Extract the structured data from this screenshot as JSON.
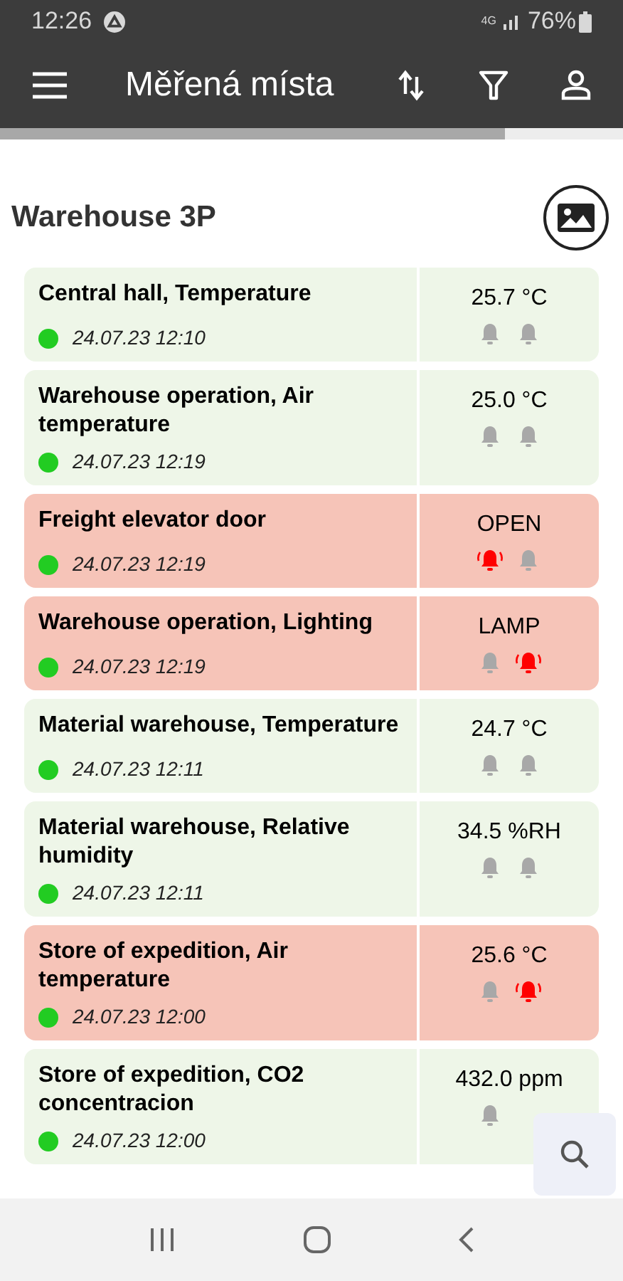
{
  "status_bar": {
    "time": "12:26",
    "network": "4G",
    "battery": "76%"
  },
  "app_bar": {
    "title": "Měřená místa"
  },
  "progress": {
    "level": 0.81
  },
  "group": {
    "title": "Warehouse 3P"
  },
  "rows": [
    {
      "name": "Central hall, Temperature",
      "time": "24.07.23 12:10",
      "color": "#22cc22",
      "value": "25.7 °C",
      "alert": false,
      "alarms": [
        {
          "active": false
        },
        {
          "active": false
        }
      ]
    },
    {
      "name": "Warehouse operation, Air temperature",
      "time": "24.07.23 12:19",
      "color": "#22cc22",
      "value": "25.0 °C",
      "alert": false,
      "alarms": [
        {
          "active": false
        },
        {
          "active": false
        }
      ]
    },
    {
      "name": "Freight elevator door",
      "time": "24.07.23 12:19",
      "color": "#22cc22",
      "value": "OPEN",
      "alert": true,
      "alarms": [
        {
          "active": true
        },
        {
          "active": false
        }
      ]
    },
    {
      "name": "Warehouse operation, Lighting",
      "time": "24.07.23 12:19",
      "color": "#22cc22",
      "value": "LAMP",
      "alert": true,
      "alarms": [
        {
          "active": false
        },
        {
          "active": true
        }
      ]
    },
    {
      "name": "Material warehouse, Temperature",
      "time": "24.07.23 12:11",
      "color": "#22cc22",
      "value": "24.7 °C",
      "alert": false,
      "alarms": [
        {
          "active": false
        },
        {
          "active": false
        }
      ]
    },
    {
      "name": "Material warehouse, Relative humidity",
      "time": "24.07.23 12:11",
      "color": "#22cc22",
      "value": "34.5 %RH",
      "alert": false,
      "alarms": [
        {
          "active": false
        },
        {
          "active": false
        }
      ]
    },
    {
      "name": "Store of expedition, Air temperature",
      "time": "24.07.23 12:00",
      "color": "#22cc22",
      "value": "25.6 °C",
      "alert": true,
      "alarms": [
        {
          "active": false
        },
        {
          "active": true
        }
      ]
    },
    {
      "name": "Store of expedition, CO2 concentracion",
      "time": "24.07.23 12:00",
      "color": "#22cc22",
      "value": "432.0 ppm",
      "alert": false,
      "alarms": [
        {
          "active": false
        }
      ]
    }
  ]
}
